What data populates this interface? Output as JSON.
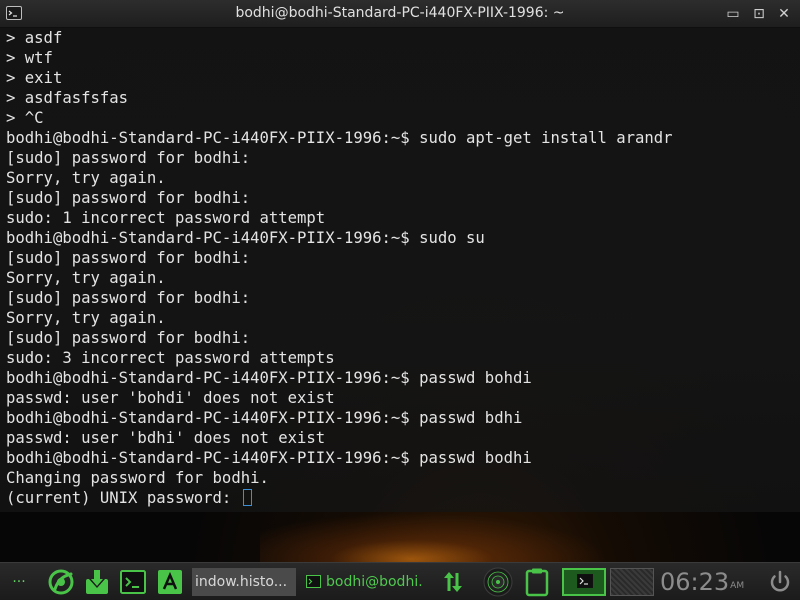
{
  "window": {
    "title": "bodhi@bodhi-Standard-PC-i440FX-PIIX-1996: ~",
    "minimize_glyph": "▭",
    "maximize_glyph": "⊡",
    "close_glyph": "✕"
  },
  "terminal": {
    "lines": [
      "> asdf",
      "> wtf",
      "> exit",
      "> asdfasfsfas",
      "> ^C",
      "bodhi@bodhi-Standard-PC-i440FX-PIIX-1996:~$ sudo apt-get install arandr",
      "[sudo] password for bodhi:",
      "Sorry, try again.",
      "[sudo] password for bodhi:",
      "sudo: 1 incorrect password attempt",
      "bodhi@bodhi-Standard-PC-i440FX-PIIX-1996:~$ sudo su",
      "[sudo] password for bodhi:",
      "Sorry, try again.",
      "[sudo] password for bodhi:",
      "Sorry, try again.",
      "[sudo] password for bodhi:",
      "sudo: 3 incorrect password attempts",
      "bodhi@bodhi-Standard-PC-i440FX-PIIX-1996:~$ passwd bohdi",
      "passwd: user 'bohdi' does not exist",
      "bodhi@bodhi-Standard-PC-i440FX-PIIX-1996:~$ passwd bdhi",
      "passwd: user 'bdhi' does not exist",
      "bodhi@bodhi-Standard-PC-i440FX-PIIX-1996:~$ passwd bodhi",
      "Changing password for bodhi.",
      "(current) UNIX password: "
    ]
  },
  "panel": {
    "menu_glyph": "···",
    "launchers": [
      "bodhi-logo-icon",
      "download-icon",
      "terminal-icon",
      "text-editor-icon"
    ],
    "tasks": [
      {
        "label": "indow.histo..."
      },
      {
        "label": "bodhi@bodhi."
      }
    ],
    "clock": {
      "time": "06:23",
      "ampm": "AM"
    },
    "colors": {
      "accent": "#49c449",
      "panel_bg": "#232323",
      "terminal_fg": "#e4e4e4",
      "cursor": "#3b8fd9"
    }
  }
}
